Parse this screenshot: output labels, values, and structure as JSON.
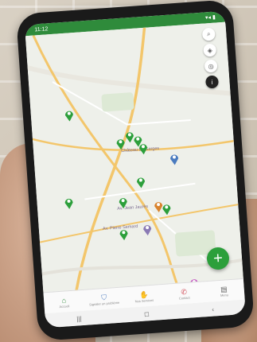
{
  "status_bar": {
    "time": "11:12",
    "icons": "▾◂ ▮"
  },
  "map": {
    "labels": [
      "Château de Garges",
      "Av. Jean Jaurès",
      "Av. Pierre Semard"
    ],
    "toolbar_icons": [
      "search-icon",
      "layers-icon",
      "target-icon",
      "info-icon"
    ]
  },
  "fab": {
    "label": "+"
  },
  "bottom_nav": [
    {
      "icon": "home-icon",
      "glyph": "⌂",
      "label": "Accueil",
      "color": "#2f8b3b"
    },
    {
      "icon": "shield-icon",
      "glyph": "⛉",
      "label": "Signaler un problème",
      "color": "#4a7bbf"
    },
    {
      "icon": "handshake-icon",
      "glyph": "✋",
      "label": "Nos Services",
      "color": "#d08a2e"
    },
    {
      "icon": "phone-icon",
      "glyph": "✆",
      "label": "Contact",
      "color": "#d04a55"
    },
    {
      "icon": "menu-icon",
      "glyph": "▤",
      "label": "Menu",
      "color": "#666666"
    }
  ],
  "system_nav": {
    "recent": "|||",
    "home": "◻",
    "back": "‹"
  },
  "colors": {
    "brand": "#2f8b3b",
    "road": "#f3c66b",
    "marker": "#2c9f3b"
  }
}
